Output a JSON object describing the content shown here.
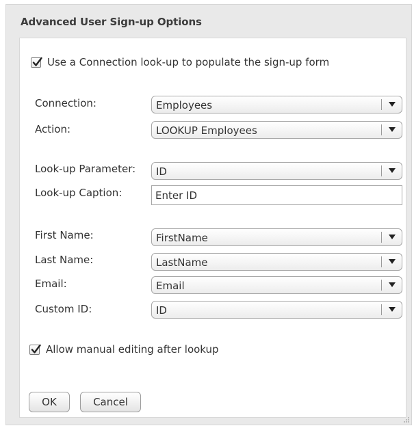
{
  "dialog": {
    "title": "Advanced User Sign-up Options"
  },
  "lookup_toggle": {
    "checked": true,
    "label": "Use a Connection look-up to populate the sign-up form"
  },
  "fields": {
    "connection": {
      "label": "Connection:",
      "value": "Employees"
    },
    "action": {
      "label": "Action:",
      "value": "LOOKUP Employees"
    },
    "lookup_parameter": {
      "label": "Look-up Parameter:",
      "value": "ID"
    },
    "lookup_caption": {
      "label": "Look-up Caption:",
      "value": "Enter ID"
    },
    "first_name": {
      "label": "First Name:",
      "value": "FirstName"
    },
    "last_name": {
      "label": "Last Name:",
      "value": "LastName"
    },
    "email": {
      "label": "Email:",
      "value": "Email"
    },
    "custom_id": {
      "label": "Custom ID:",
      "value": "ID"
    }
  },
  "manual_edit_toggle": {
    "checked": true,
    "label": "Allow manual editing after lookup"
  },
  "buttons": {
    "ok": "OK",
    "cancel": "Cancel"
  },
  "icons": {
    "checkmark": "checkmark-icon",
    "dropdown": "triangle-down-icon",
    "resize": "resize-grip-icon"
  }
}
